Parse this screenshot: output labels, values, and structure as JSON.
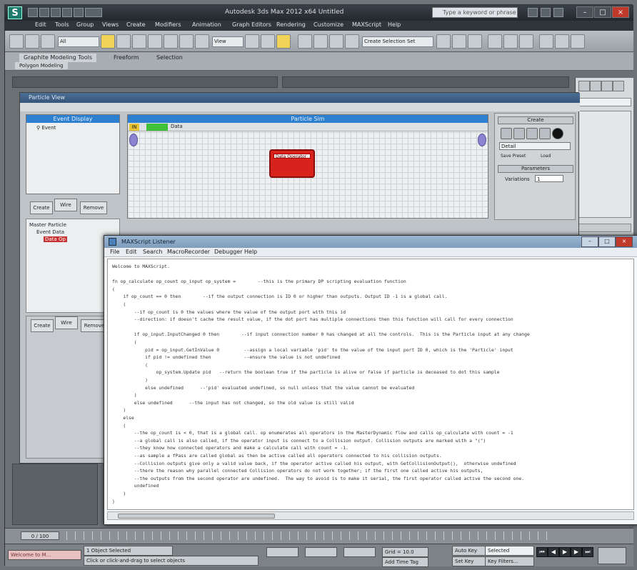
{
  "app": {
    "title": "Autodesk 3ds Max 2012 x64    Untitled",
    "search_placeholder": "Type a keyword or phrase",
    "menus": [
      "Edit",
      "Tools",
      "Group",
      "Views",
      "Create",
      "Modifiers",
      "Animation",
      "Graph Editors",
      "Rendering",
      "Customize",
      "MAXScript",
      "Help"
    ],
    "ribbon_tabs": [
      "Graphite Modeling Tools",
      "Freeform",
      "Selection"
    ],
    "ribbon_sub": "Polygon Modeling",
    "toolbar_dd": "All",
    "toolbar_dd2": "View",
    "toolbar_dd3": "Create Selection Set"
  },
  "particle_view": {
    "title": "Particle View",
    "depot_header": "Event Display",
    "depot_item": "Event",
    "grid_header": "Particle Sim",
    "grid_text": "Data",
    "node_label": "Data Operator",
    "left_buttons": [
      "Create",
      "Wire",
      "Remove"
    ],
    "tree_items": [
      "Master Particle",
      "Event Data",
      "Data Op"
    ],
    "right_header": "Create",
    "right_dd": "Detail",
    "right_btns": [
      "Save Preset",
      "Load"
    ],
    "params_header": "Parameters",
    "variations_label": "Variations",
    "variations_value": "1"
  },
  "listener": {
    "title": "MAXScript Listener",
    "menus": [
      "File",
      "Edit",
      "Search",
      "MacroRecorder",
      "Debugger",
      "Help"
    ],
    "lines": [
      "Welcome to MAXScript.",
      "",
      "fn op_calculate op_count op_input op_system =        --this is the primary DP scripting evaluation function",
      "(",
      "    if op_count == 0 then        --if the output connection is ID 0 or higher than outputs. Output ID -1 is a global call.",
      "    (",
      "        --if op_count is 0 the values where the value of the output port with this id",
      "        --direction: if doesn't cache the result value, if the dot port has multiple connections then this function will call for every connection",
      "",
      "        if op_input.InputChanged 0 then        --if input connection number 0 has changed at all the controls.  This is the Particle input at any change",
      "        (",
      "            pid = op_input.GetInValue 0         --assign a local variable 'pid' to the value of the input port ID 0, which is the 'Particle' input",
      "            if pid != undefined then            --ensure the value is not undefined",
      "            (",
      "                op_system.Update pid   --return the boolean true if the particle is alive or false if particle is deceased to dot this sample",
      "            )",
      "            else undefined      --'pid' evaluated undefined, so null unless that the value cannot be evaluated",
      "        )",
      "        else undefined      --the input has not changed, so the old value is still valid",
      "    )",
      "    else",
      "    (",
      "        --the op_count is < 0, that is a global call. op enumerates all operators in the MasterDynamic flow and calls op_calculate with count = -1",
      "        --a global call is also called, if the operator input is connect to a Collision output. Collision outputs are marked with a \"(\")",
      "        --they know how connected operators and make a calculate call with count = -1.",
      "        --as sample a fPass are called global as then be active called all operators connected to his collision outputs.",
      "        --Collision outputs give only a valid value back, if the operator active called his output, with GetCollisionOutput(),  otherwise undefined",
      "        --there the reason why parallel connected Collision operators do not work together; if the first one called active his outputs,",
      "        --the outputs from the second operator are undefined.  The way to avoid is to make it serial, the first operator called active the second one.",
      "        undefined",
      "    )",
      ")"
    ]
  },
  "bottom": {
    "frame": "0 / 100",
    "status_selected": "1 Object Selected",
    "status_prompt": "Click or click-and-drag to select objects",
    "coord_grid": "Grid = 10.0",
    "auto_key": "Auto Key",
    "auto_key_value": "Selected",
    "set_key": "Set Key",
    "key_filters": "Key Filters...",
    "add_time_tag": "Add Time Tag",
    "welcome": "Welcome to M..."
  },
  "colors": {
    "accent_blue": "#2d7fcf",
    "node_red": "#d8221c",
    "yellow": "#e6c430",
    "green": "#3fbf3a"
  }
}
